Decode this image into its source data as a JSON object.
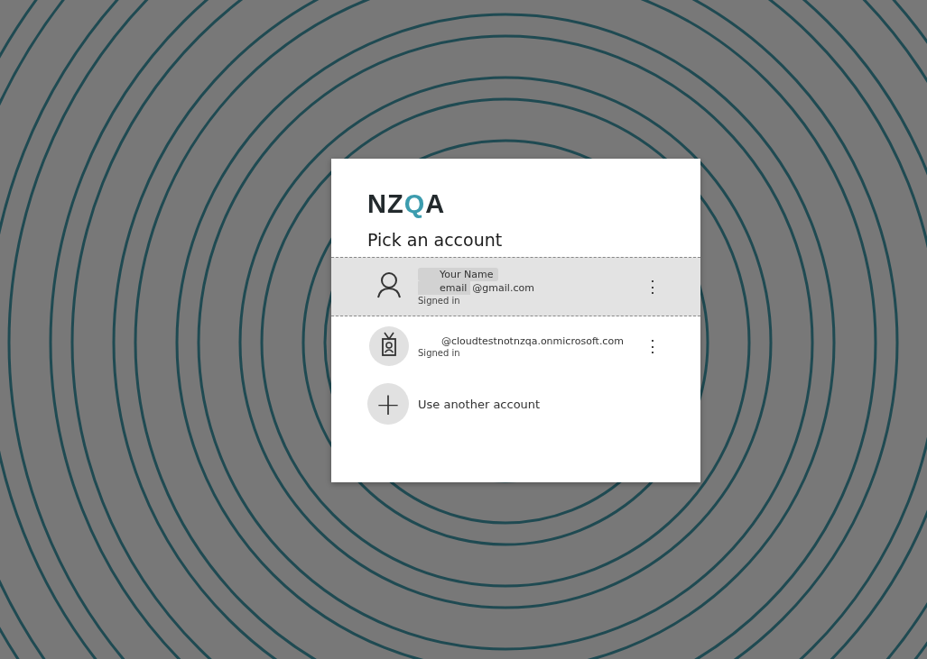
{
  "logo": "NZQA",
  "title": "Pick an account",
  "accounts": [
    {
      "kind": "personal",
      "selected": true,
      "name": "Your Name",
      "email_redacted": "email",
      "email": "@gmail.com",
      "status": "Signed in",
      "menu": "⋮"
    },
    {
      "kind": "work",
      "selected": false,
      "email": "@cloudtestnotnzqa.onmicrosoft.com",
      "status": "Signed in",
      "menu": "⋮"
    }
  ],
  "add_account": {
    "icon": "+",
    "label": "Use another account"
  }
}
